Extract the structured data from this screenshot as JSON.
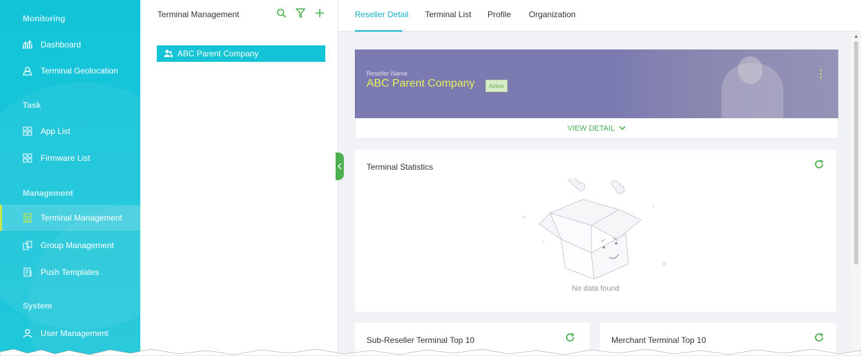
{
  "sidebar": {
    "sections": [
      {
        "title": "Monitoring",
        "items": [
          {
            "label": "Dashboard",
            "icon": "chart-icon"
          },
          {
            "label": "Terminal Geolocation",
            "icon": "geolocation-icon"
          }
        ]
      },
      {
        "title": "Task",
        "items": [
          {
            "label": "App List",
            "icon": "grid-icon"
          },
          {
            "label": "Firmware List",
            "icon": "grid-icon"
          }
        ]
      },
      {
        "title": "Management",
        "items": [
          {
            "label": "Terminal Management",
            "icon": "document-icon",
            "active": true
          },
          {
            "label": "Group Management",
            "icon": "group-icon"
          },
          {
            "label": "Push Templates",
            "icon": "template-icon"
          }
        ]
      },
      {
        "title": "System",
        "items": [
          {
            "label": "User Management",
            "icon": "user-icon"
          }
        ]
      }
    ]
  },
  "tree": {
    "title": "Terminal Management",
    "nodes": [
      {
        "label": "ABC Parent Company",
        "icon": "users-icon",
        "selected": true
      }
    ]
  },
  "tabs": [
    {
      "label": "Reseller Detail",
      "active": true
    },
    {
      "label": "Terminal List"
    },
    {
      "label": "Profile"
    },
    {
      "label": "Organization"
    }
  ],
  "reseller": {
    "label": "Reseller Name",
    "name": "ABC Parent Company",
    "status": "Active",
    "view_detail": "VIEW DETAIL"
  },
  "stats": {
    "title": "Terminal Statistics",
    "empty_text": "No data found"
  },
  "bottom_cards": [
    {
      "title": "Sub-Reseller Terminal Top 10"
    },
    {
      "title": "Merchant Terminal Top 10"
    }
  ],
  "colors": {
    "sidebar": "#12c3d8",
    "accent": "#14b3c8",
    "green": "#4caf50",
    "banner": "#7b7ab1",
    "name_yellow": "#e4f05c"
  }
}
